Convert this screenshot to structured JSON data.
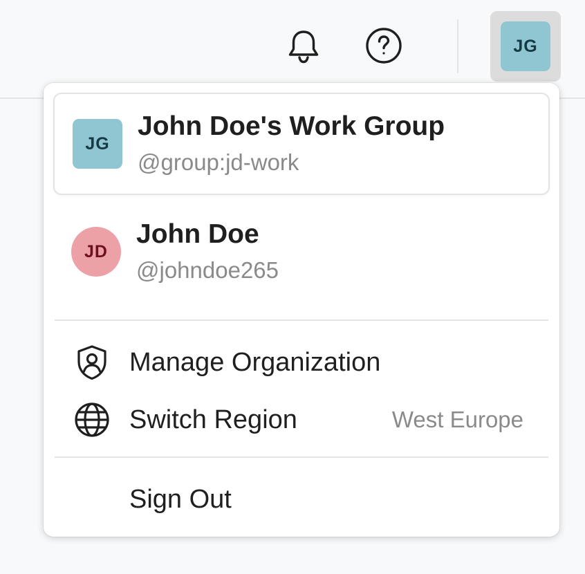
{
  "topbar": {
    "bell_icon": "bell-icon",
    "help_icon": "question-circle-icon",
    "avatar_initials": "JG"
  },
  "menu": {
    "accounts": [
      {
        "initials": "JG",
        "name": "John Doe's Work Group",
        "handle": "@group:jd-work",
        "shape": "square",
        "color": "#8fc6d2",
        "selected": true
      },
      {
        "initials": "JD",
        "name": "John Doe",
        "handle": "@johndoe265",
        "shape": "circle",
        "color": "#eca1a6",
        "selected": false
      }
    ],
    "items": [
      {
        "label": "Manage Organization",
        "icon": "shield-person-icon"
      },
      {
        "label": "Switch Region",
        "value": "West Europe",
        "icon": "globe-icon"
      }
    ],
    "sign_out_label": "Sign Out"
  }
}
